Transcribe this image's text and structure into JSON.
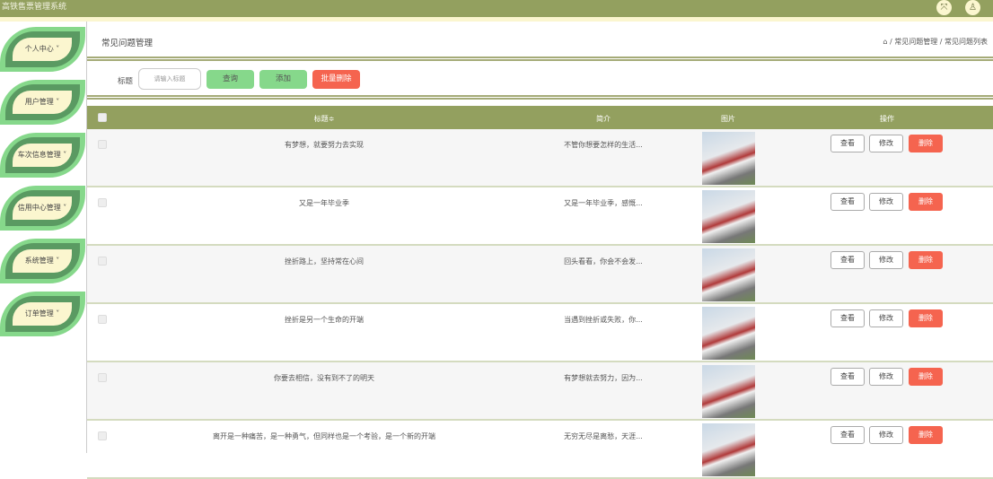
{
  "app": {
    "title": "高铁售票管理系统"
  },
  "sidebar": {
    "items": [
      {
        "label": "个人中心 ˅"
      },
      {
        "label": "用户管理 ˅"
      },
      {
        "label": "车次信息管理 ˅"
      },
      {
        "label": "信用中心管理 ˅"
      },
      {
        "label": "系统管理 ˅"
      },
      {
        "label": "订单管理 ˅"
      }
    ]
  },
  "page": {
    "title": "常见问题管理",
    "breadcrumb": [
      "常见问题管理",
      "常见问题列表"
    ],
    "sep": "/"
  },
  "search": {
    "label": "标题",
    "placeholder": "请输入标题",
    "query": "查询",
    "add": "添加",
    "batch_delete": "批量删除"
  },
  "table": {
    "headers": [
      "标题≑",
      "简介",
      "图片",
      "操作"
    ],
    "actions": {
      "view": "查看",
      "edit": "修改",
      "delete": "删除"
    },
    "rows": [
      {
        "title": "有梦想，就要努力去实现",
        "intro": "不管你想要怎样的生活..."
      },
      {
        "title": "又是一年毕业季",
        "intro": "又是一年毕业季，感慨..."
      },
      {
        "title": "挫折路上，坚持常在心间",
        "intro": "回头看看，你会不会发..."
      },
      {
        "title": "挫折是另一个生命的开端",
        "intro": "当遇到挫折或失败，你..."
      },
      {
        "title": "你要去相信，没有到不了的明天",
        "intro": "有梦想就去努力，因为..."
      },
      {
        "title": "离开是一种痛苦，是一种勇气，但同样也是一个考验，是一个新的开端",
        "intro": "无穷无尽是离愁，天涯..."
      }
    ]
  },
  "colors": {
    "olive": "#93a05f",
    "green": "#86d88b",
    "red": "#f5644f"
  }
}
